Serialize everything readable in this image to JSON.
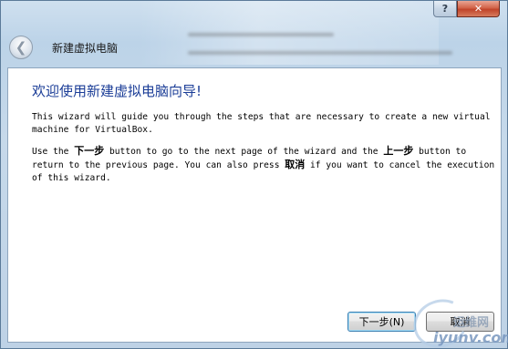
{
  "window": {
    "help_label": "?",
    "close_label": "✕"
  },
  "header": {
    "back_icon": "back-arrow-icon",
    "title": "新建虚拟电脑"
  },
  "page": {
    "heading": "欢迎使用新建虚拟电脑向导!",
    "para1": "This wizard will guide you through the steps that are necessary to create a new virtual machine for VirtualBox.",
    "para2_a": "Use the ",
    "para2_next": "下一步",
    "para2_b": " button to go to the next page of the wizard and the ",
    "para2_prev": "上一步",
    "para2_c": " button to return to the previous page. You can also press ",
    "para2_cancel": "取消",
    "para2_d": " if you want to cancel the execution of this wizard."
  },
  "footer": {
    "next_label": "下一步(N)",
    "cancel_label": "取消"
  },
  "watermark": {
    "text1": "运维网",
    "text2": "iyunv.com"
  }
}
